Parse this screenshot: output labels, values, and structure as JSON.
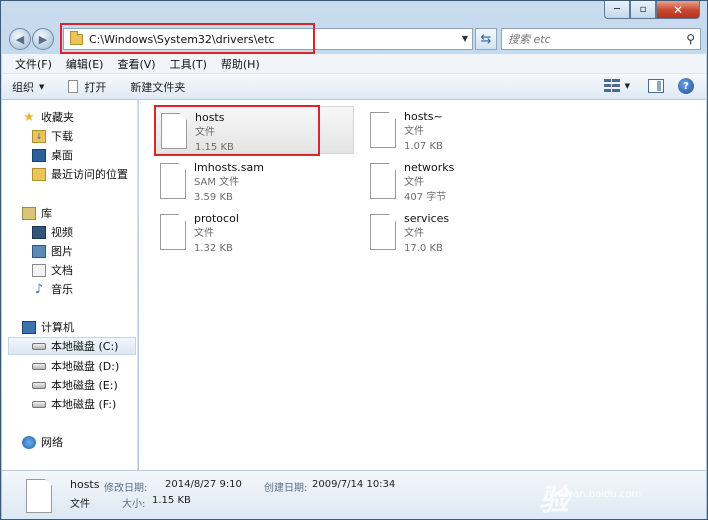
{
  "window": {
    "minimize": "─",
    "maximize": "▫",
    "close": "✕"
  },
  "address": {
    "path": "C:\\Windows\\System32\\drivers\\etc"
  },
  "search": {
    "placeholder": "搜索 etc"
  },
  "menu": [
    "文件(F)",
    "编辑(E)",
    "查看(V)",
    "工具(T)",
    "帮助(H)"
  ],
  "toolbar": {
    "organize": "组织",
    "open": "打开",
    "new_folder": "新建文件夹"
  },
  "nav": {
    "favorites": "收藏夹",
    "downloads": "下载",
    "desktop": "桌面",
    "recent": "最近访问的位置",
    "libraries": "库",
    "videos": "视频",
    "pictures": "图片",
    "documents": "文档",
    "music": "音乐",
    "computer": "计算机",
    "drive_c": "本地磁盘 (C:)",
    "drive_d": "本地磁盘 (D:)",
    "drive_e": "本地磁盘 (E:)",
    "drive_f": "本地磁盘 (F:)",
    "network": "网络"
  },
  "files": [
    {
      "name": "hosts",
      "type": "文件",
      "size": "1.15 KB"
    },
    {
      "name": "hosts~",
      "type": "文件",
      "size": "1.07 KB"
    },
    {
      "name": "lmhosts.sam",
      "type": "SAM 文件",
      "size": "3.59 KB"
    },
    {
      "name": "networks",
      "type": "文件",
      "size": "407 字节"
    },
    {
      "name": "protocol",
      "type": "文件",
      "size": "1.32 KB"
    },
    {
      "name": "services",
      "type": "文件",
      "size": "17.0 KB"
    }
  ],
  "details": {
    "name": "hosts",
    "type": "文件",
    "modified_label": "修改日期:",
    "modified": "2014/8/27 9:10",
    "created_label": "创建日期:",
    "created": "2009/7/14 10:34",
    "size_label": "大小:",
    "size": "1.15 KB"
  },
  "watermark": {
    "logo": "Baidu经验",
    "url": "jingyan.baidu.com"
  },
  "colors": {
    "highlight": "#d9262b",
    "accent": "#2f5f9a"
  }
}
